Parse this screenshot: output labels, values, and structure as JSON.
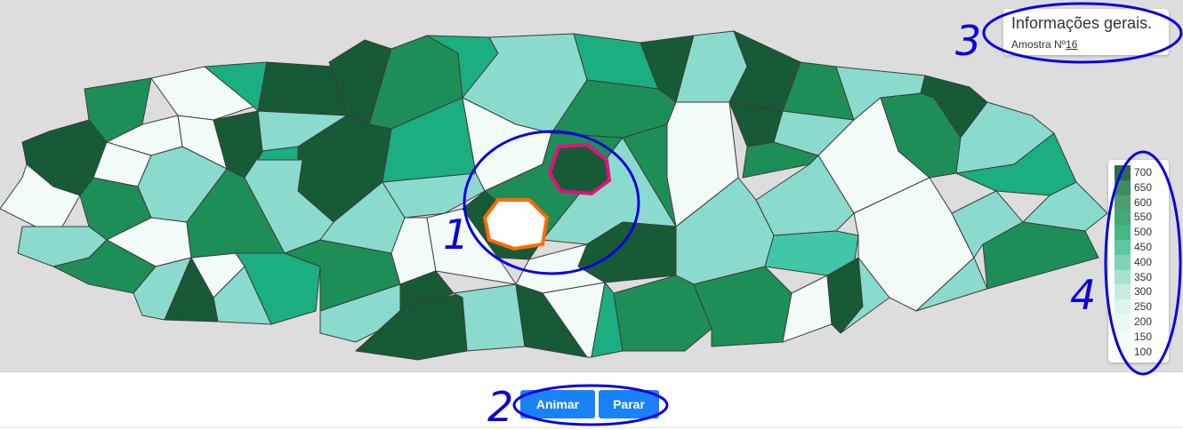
{
  "info_panel": {
    "title": "Informações gerais.",
    "sample_label": "Amostra Nº",
    "sample_number": "16"
  },
  "legend": {
    "items": [
      {
        "label": "700",
        "color": "#2e6b48"
      },
      {
        "label": "650",
        "color": "#3f8c5f"
      },
      {
        "label": "600",
        "color": "#4f9c6f"
      },
      {
        "label": "550",
        "color": "#43a873"
      },
      {
        "label": "500",
        "color": "#43b889"
      },
      {
        "label": "450",
        "color": "#5ec6a2"
      },
      {
        "label": "400",
        "color": "#7ed4ba"
      },
      {
        "label": "350",
        "color": "#a6e2d2"
      },
      {
        "label": "300",
        "color": "#c7ece4"
      },
      {
        "label": "250",
        "color": "#dcf4ef"
      },
      {
        "label": "200",
        "color": "#eaf8f5"
      },
      {
        "label": "150",
        "color": "#f3fbf9"
      },
      {
        "label": "100",
        "color": "#fafdfc"
      }
    ]
  },
  "controls": {
    "animate_label": "Animar",
    "stop_label": "Parar"
  },
  "annotations": {
    "marker_1": "1",
    "marker_2": "2",
    "marker_3": "3",
    "marker_4": "4"
  },
  "colors": {
    "accent_button": "#1a82f7",
    "annotation_blue": "#0a00e0",
    "highlight_pink": "#e0127e",
    "highlight_orange": "#ff6a00",
    "map_background": "#dddddd"
  }
}
